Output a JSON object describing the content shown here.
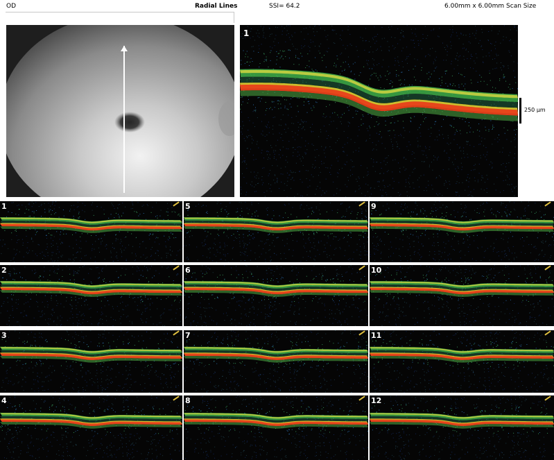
{
  "header": {
    "eye": "OD",
    "scan_pattern": "Radial Lines",
    "ssi": "SSI= 64.2",
    "scan_size": "6.00mm x 6.00mm Scan Size"
  },
  "main_scan": {
    "number": "1"
  },
  "scale": {
    "label": "250 µm"
  },
  "thumbnails": [
    {
      "number": "1"
    },
    {
      "number": "5"
    },
    {
      "number": "9"
    },
    {
      "number": "2"
    },
    {
      "number": "6"
    },
    {
      "number": "10"
    },
    {
      "number": "3"
    },
    {
      "number": "7"
    },
    {
      "number": "11"
    },
    {
      "number": "4"
    },
    {
      "number": "8"
    },
    {
      "number": "12"
    }
  ],
  "colors": {
    "rpe": "#e8401a",
    "nfl": "#7fd23c",
    "background": "#050505"
  }
}
